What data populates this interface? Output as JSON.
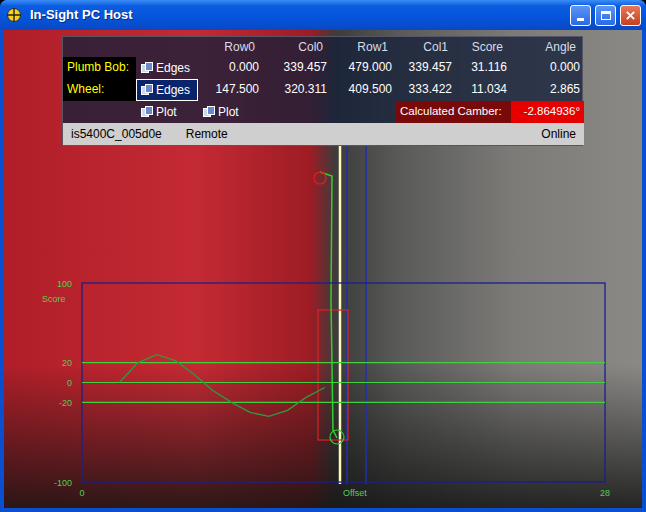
{
  "window": {
    "title": "In-Sight PC Host"
  },
  "spreadsheet": {
    "columns": [
      "Row0",
      "Col0",
      "Row1",
      "Col1",
      "Score",
      "Angle"
    ],
    "rows": [
      {
        "label": "Plumb Bob:",
        "tool": "Edges",
        "selected": false,
        "values": [
          "0.000",
          "339.457",
          "479.000",
          "339.457",
          "31.116",
          "0.000"
        ]
      },
      {
        "label": "Wheel:",
        "tool": "Edges",
        "selected": true,
        "values": [
          "147.500",
          "320.311",
          "409.500",
          "333.422",
          "11.034",
          "2.865"
        ]
      }
    ],
    "plots": [
      "Plot",
      "Plot"
    ],
    "result": {
      "label": "Calculated Camber:",
      "value": "-2.864936°"
    },
    "status": {
      "sensor": "is5400C_005d0e",
      "mode": "Remote",
      "state": "Online"
    }
  },
  "chart": {
    "y_label": "Score",
    "x_label": "Offset",
    "y_ticks": [
      {
        "label": "100",
        "value": 100
      },
      {
        "label": "20",
        "value": 20
      },
      {
        "label": "0",
        "value": 0
      },
      {
        "label": "-20",
        "value": -20
      },
      {
        "label": "-100",
        "value": -100
      }
    ],
    "x_ticks": [
      {
        "label": "0",
        "value": 0
      },
      {
        "label": "28",
        "value": 28
      }
    ],
    "thresholds": [
      20,
      0,
      -20
    ],
    "series": [
      {
        "name": "score",
        "start": 2,
        "values": [
          0,
          20,
          28,
          22,
          8,
          -8,
          -20,
          -30,
          -34,
          -28,
          -15,
          -5
        ]
      }
    ]
  }
}
